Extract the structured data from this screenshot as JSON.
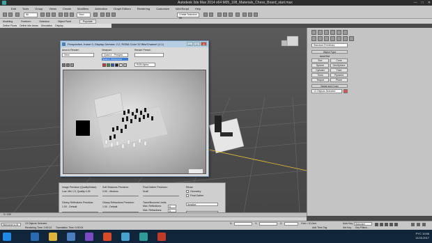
{
  "window": {
    "title": "Autodesk 3ds Max  2014 x64     M05_108_Materials_Chess_Board_start.max",
    "controls": [
      "—",
      "□",
      "✕"
    ]
  },
  "menubar": [
    "Edit",
    "Tools",
    "Group",
    "Views",
    "Create",
    "Modifiers",
    "Animation",
    "Graph Editors",
    "Rendering",
    "Customize",
    "MAXScript",
    "Help"
  ],
  "toolbar": {
    "filter_select": "All",
    "view_select": "View",
    "selection_set": "Create Selection Se"
  },
  "ribbon": {
    "tabs": [
      "Modeling",
      "Freeform",
      "Selection",
      "Object Paint",
      "Populate"
    ],
    "active_tab": "Populate",
    "subtabs": [
      "Define Flows",
      "Define Idle Areas",
      "Simulation",
      "Display"
    ]
  },
  "command_panel": {
    "category_select": "Standard Primitives",
    "object_type_header": "Object Type",
    "autogrid": "AutoGrid",
    "objects": [
      "Box",
      "Cone",
      "Sphere",
      "GeoSphere",
      "Cylinder",
      "Tube",
      "Torus",
      "Pyramid",
      "Teapot",
      "Plane"
    ],
    "name_color_header": "Name and Color",
    "name_field": "13 Objects Selected"
  },
  "render_frame": {
    "title": "Perspective, frame 0, Display Gamma: 2.2, RGBA Color 32 Bits/Channel (1:1)",
    "area_to_render_label": "Area to Render:",
    "area_to_render": "View",
    "viewport_label": "Viewport:",
    "viewport_value": "Quad 4 - Perspec",
    "viewport_highlight": "Quad 4 - Perspective",
    "render_preset_label": "Render Preset:",
    "render_preset_value": "",
    "channel_select": "RGB Alpha"
  },
  "render_settings": {
    "image_precision_label": "Image Precision (Quality/Noise):",
    "image_precision_value": "Low: Min 1.0, Quality 0.25",
    "soft_shadows_label": "Soft Shadows Precision:",
    "soft_shadows_value": "0.5X - Medium",
    "final_gather_label": "Final Gather Precision:",
    "final_gather_value": "Draft",
    "glossy_reflections_label": "Glossy Reflections Precision:",
    "glossy_reflections_value": "1.0X - Default",
    "glossy_refractions_label": "Glossy Refractions Precision:",
    "glossy_refractions_value": "1.0X - Default",
    "reuse_label": "Reuse",
    "geometry_label": "Geometry",
    "final_gather_cb": "Final Gather",
    "trace_label": "Trace/Bounces Limits",
    "max_reflections_label": "Max. Reflections:",
    "max_reflections": "6",
    "max_refractions_label": "Max. Refractions:",
    "max_refractions": "6",
    "fg_bounces_label": "FG Bounces:",
    "fg_bounces": "0",
    "production_select": "Iterative",
    "render_button": "Render"
  },
  "timeline": {
    "position": "0 / 100"
  },
  "status": {
    "maxscript_prompt": "Welcome to M",
    "selection": "13 Objects Selected",
    "rendering_time": "Rendering Time: 0:00:12",
    "translation_time": "Translation Time: 0:00:04",
    "x_label": "X:",
    "y_label": "Y:",
    "z_label": "Z:",
    "grid": "Grid = 10,0cm",
    "add_time_tag": "Add Time Tag",
    "auto_key": "Auto Key",
    "set_key": "Set Key",
    "key_mode": "Selected",
    "key_filters": "Key Filters..."
  },
  "taskbar": {
    "lang": "PYC",
    "time": "10:56",
    "date": "13.03.2017"
  },
  "colors": {
    "titlebar": "#2d2d2d",
    "ribbon": "#c8c8c8",
    "viewport": "#4b4b4b",
    "taskbar": "#10243a",
    "render_title": "#b7cde4"
  }
}
